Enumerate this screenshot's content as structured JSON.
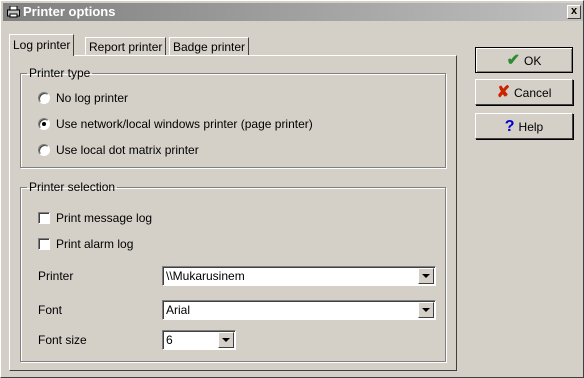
{
  "window": {
    "title": "Printer options",
    "close_label": "x"
  },
  "tabs": [
    {
      "label": "Log printer",
      "active": true
    },
    {
      "label": "Report printer",
      "active": false
    },
    {
      "label": "Badge printer",
      "active": false
    }
  ],
  "printer_type": {
    "legend": "Printer type",
    "options": [
      {
        "label": "No log printer",
        "checked": false
      },
      {
        "label": "Use network/local windows printer (page printer)",
        "checked": true
      },
      {
        "label": "Use local dot matrix printer",
        "checked": false
      }
    ]
  },
  "printer_selection": {
    "legend": "Printer selection",
    "checkboxes": [
      {
        "label": "Print message log",
        "checked": false
      },
      {
        "label": "Print alarm log",
        "checked": false
      }
    ],
    "printer_label": "Printer",
    "printer_value": "\\\\Mukarusinem",
    "font_label": "Font",
    "font_value": "Arial",
    "font_size_label": "Font size",
    "font_size_value": "6"
  },
  "buttons": {
    "ok": {
      "label": "OK",
      "icon": "checkmark-icon",
      "color": "#2e8b2e"
    },
    "cancel": {
      "label": "Cancel",
      "icon": "x-icon",
      "color": "#cc2200"
    },
    "help": {
      "label": "Help",
      "icon": "question-icon",
      "color": "#0000cc"
    }
  }
}
